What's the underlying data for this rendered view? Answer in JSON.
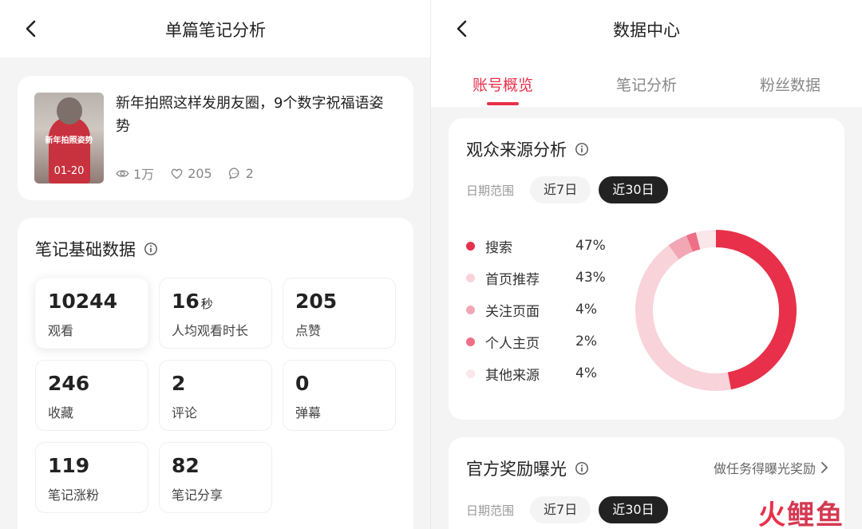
{
  "left": {
    "nav_title": "单篇笔记分析",
    "note": {
      "thumb_caption": "新年拍照姿势",
      "thumb_date": "01-20",
      "title": "新年拍照这样发朋友圈，9个数字祝福语姿势",
      "views": "1万",
      "likes": "205",
      "comments": "2"
    },
    "basic": {
      "title": "笔记基础数据",
      "metrics": [
        {
          "value": "10244",
          "unit": "",
          "label": "观看"
        },
        {
          "value": "16",
          "unit": "秒",
          "label": "人均观看时长"
        },
        {
          "value": "205",
          "unit": "",
          "label": "点赞"
        },
        {
          "value": "246",
          "unit": "",
          "label": "收藏"
        },
        {
          "value": "2",
          "unit": "",
          "label": "评论"
        },
        {
          "value": "0",
          "unit": "",
          "label": "弹幕"
        },
        {
          "value": "119",
          "unit": "",
          "label": "笔记涨粉"
        },
        {
          "value": "82",
          "unit": "",
          "label": "笔记分享"
        }
      ]
    }
  },
  "right": {
    "nav_title": "数据中心",
    "tabs": [
      "账号概览",
      "笔记分析",
      "粉丝数据"
    ],
    "active_tab": 0,
    "audience": {
      "title": "观众来源分析",
      "date_label": "日期范围",
      "chips": [
        "近7日",
        "近30日"
      ],
      "active_chip": 1
    },
    "reward": {
      "title": "官方奖励曝光",
      "link": "做任务得曝光奖励",
      "date_label": "日期范围",
      "chips": [
        "近7日",
        "近30日"
      ],
      "active_chip": 1
    }
  },
  "chart_data": {
    "type": "pie",
    "variant": "donut",
    "categories": [
      "搜索",
      "首页推荐",
      "关注页面",
      "个人主页",
      "其他来源"
    ],
    "values": [
      47,
      43,
      4,
      2,
      4
    ],
    "labels": [
      "47%",
      "43%",
      "4%",
      "2%",
      "4%"
    ],
    "colors": [
      "#e8304a",
      "#f9d3da",
      "#f2a7b4",
      "#ee6f86",
      "#fbe6ea"
    ],
    "legend_position": "left"
  },
  "watermark": {
    "part1": "火",
    "part2": "鲤鱼"
  }
}
